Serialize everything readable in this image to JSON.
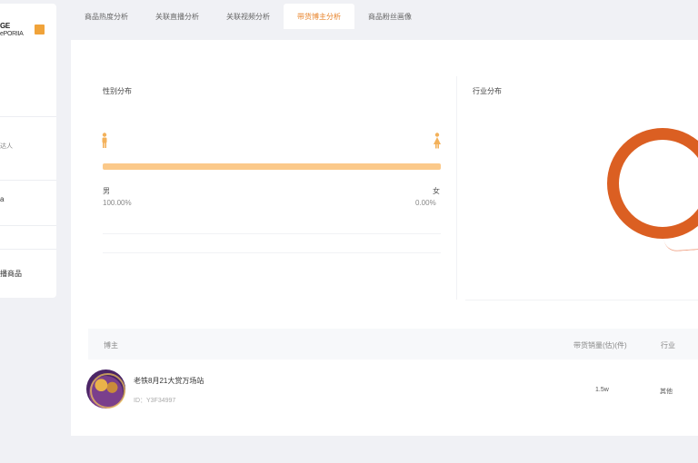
{
  "sidebar": {
    "logo_line1": "GE",
    "logo_line2": "ePORIIA",
    "item1": "达人",
    "item2": "a",
    "item3": "播商品"
  },
  "tabs": [
    {
      "label": "商品热度分析",
      "active": false
    },
    {
      "label": "关联直播分析",
      "active": false
    },
    {
      "label": "关联视频分析",
      "active": false
    },
    {
      "label": "带货博主分析",
      "active": true
    },
    {
      "label": "商品粉丝画像",
      "active": false
    }
  ],
  "gender": {
    "title": "性别分布",
    "male_label": "男",
    "male_value": "100.00%",
    "female_label": "女",
    "female_value": "0.00%",
    "male_share": 100
  },
  "industry": {
    "title": "行业分布"
  },
  "table": {
    "col_blogger": "博主",
    "col_sales": "带货销量(估)(件)",
    "col_industry": "行业",
    "rows": [
      {
        "name": "老铁8月21大赏万场站",
        "id": "ID：Y3F34997",
        "sales": "1.5w",
        "industry": "其他"
      }
    ]
  },
  "colors": {
    "accent": "#e8832a",
    "bar": "#fbc98a",
    "donut": "#db5f22"
  }
}
